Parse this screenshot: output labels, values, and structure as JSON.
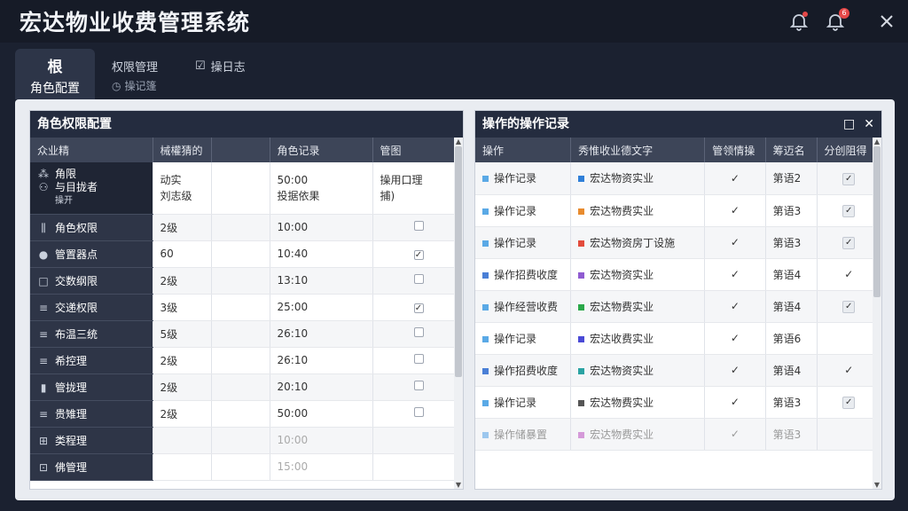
{
  "app": {
    "title": "宏达物业收费管理系统",
    "notification_badge": "6"
  },
  "tabs": {
    "active": {
      "label": "根",
      "sublabel": "角色配置"
    },
    "second": {
      "label": "权限管理",
      "sublabel": "操记篷"
    },
    "third": {
      "label": "操日志"
    }
  },
  "left_panel": {
    "title": "角色权限配置",
    "columns": [
      "众业精",
      "械權猜的",
      "",
      "角色记录",
      "管图"
    ],
    "first_row": {
      "name_line1": "角限",
      "name_line2": "与目拢者",
      "name_line3": "操开",
      "c2_line1": "动实",
      "c2_line2": "刘志级",
      "c4_line1": "50:00",
      "c4_line2": "投据依果",
      "c5_line1": "操用口理",
      "c5_line2": "捕)"
    },
    "rows": [
      {
        "icon": "chart-icon",
        "glyph": "⫼",
        "name": "角色权限",
        "level": "2级",
        "time": "10:00",
        "checked": false
      },
      {
        "icon": "globe-icon",
        "glyph": "●",
        "name": "管置器点",
        "level": "60",
        "time": "10:40",
        "checked": true
      },
      {
        "icon": "square-icon",
        "glyph": "□",
        "name": "交数纲限",
        "level": "2级",
        "time": "13:10",
        "checked": false
      },
      {
        "icon": "list-icon",
        "glyph": "≡",
        "name": "交递权限",
        "level": "3级",
        "time": "25:00",
        "checked": true
      },
      {
        "icon": "list-icon",
        "glyph": "≡",
        "name": "布温三统",
        "level": "5级",
        "time": "26:10",
        "checked": false
      },
      {
        "icon": "list-icon",
        "glyph": "≡",
        "name": "希控理",
        "level": "2级",
        "time": "26:10",
        "checked": false
      },
      {
        "icon": "bars-icon",
        "glyph": "▮",
        "name": "管拢理",
        "level": "2级",
        "time": "20:10",
        "checked": false
      },
      {
        "icon": "list-icon",
        "glyph": "≡",
        "name": "贵雉理",
        "level": "2级",
        "time": "50:00",
        "checked": false
      },
      {
        "icon": "grid-icon",
        "glyph": "⊞",
        "name": "类程理",
        "level": "",
        "time": "10:00",
        "checked": null
      },
      {
        "icon": "grid-icon",
        "glyph": "⊡",
        "name": "佛管理",
        "level": "",
        "time": "15:00",
        "checked": null
      }
    ]
  },
  "right_panel": {
    "title": "操作的操作记录",
    "maximize_icon": "□",
    "close_icon": "✕",
    "columns": [
      "操作",
      "秀惟收业德文字",
      "管领情操",
      "筹迈名",
      "分创阻得"
    ],
    "rows": [
      {
        "op": "操作记录",
        "op_color": "#5aa9e6",
        "item": "宏达物资实业",
        "item_color": "#2f7fd8",
        "mark": "✓",
        "name": "第语2",
        "checked": true
      },
      {
        "op": "操作记录",
        "op_color": "#5aa9e6",
        "item": "宏达物费实业",
        "item_color": "#e88b2e",
        "mark": "✓",
        "name": "第语3",
        "checked": true
      },
      {
        "op": "操作记录",
        "op_color": "#5aa9e6",
        "item": "宏达物资房丁设施",
        "item_color": "#e34b3c",
        "mark": "✓",
        "name": "第语3",
        "checked": true
      },
      {
        "op": "操作招费收度",
        "op_color": "#4a7fd6",
        "item": "宏达物资实业",
        "item_color": "#8f5bd1",
        "mark": "✓",
        "name": "第语4",
        "checked": false
      },
      {
        "op": "操作经营收费",
        "op_color": "#5aa9e6",
        "item": "宏达物费实业",
        "item_color": "#2ba84a",
        "mark": "✓",
        "name": "第语4",
        "checked": true
      },
      {
        "op": "操作记录",
        "op_color": "#5aa9e6",
        "item": "宏达收费实业",
        "item_color": "#4a4ad6",
        "mark": "✓",
        "name": "第语6",
        "checked": null
      },
      {
        "op": "操作招费收度",
        "op_color": "#4a7fd6",
        "item": "宏达物资实业",
        "item_color": "#2aa3a3",
        "mark": "✓",
        "name": "第语4",
        "checked": false
      },
      {
        "op": "操作记录",
        "op_color": "#5aa9e6",
        "item": "宏达物费实业",
        "item_color": "#555555",
        "mark": "✓",
        "name": "第语3",
        "checked": true
      },
      {
        "op": "操作储暴置",
        "op_color": "#9cc7ee",
        "item": "宏达物费实业",
        "item_color": "#d59ad9",
        "mark": "✓",
        "name": "第语3",
        "checked": null
      }
    ]
  }
}
